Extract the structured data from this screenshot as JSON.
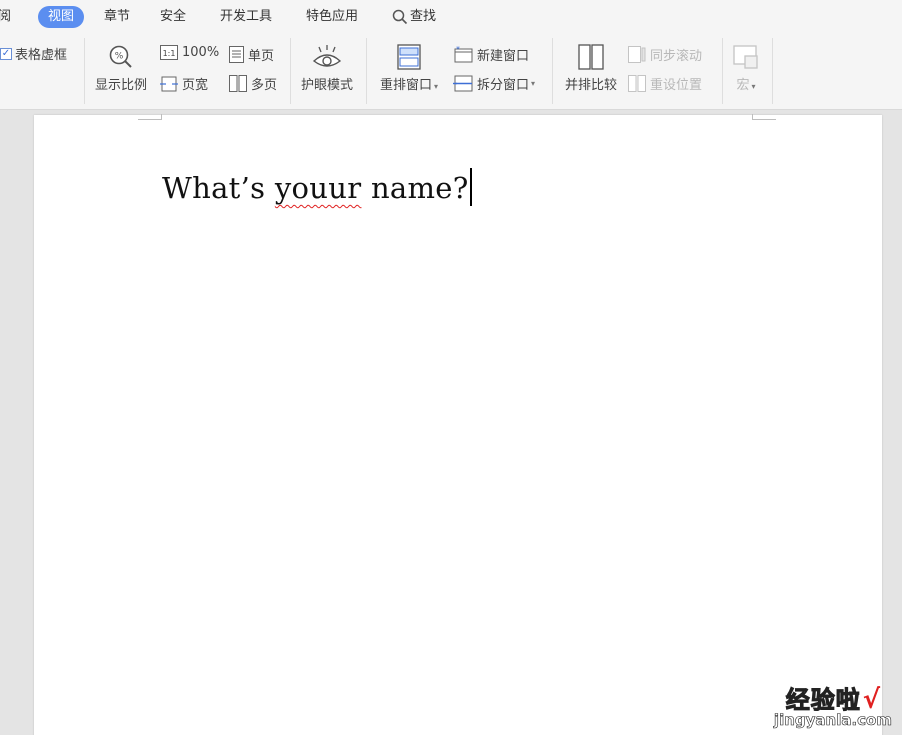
{
  "tabs": [
    {
      "label": "审阅"
    },
    {
      "label": "视图"
    },
    {
      "label": "章节"
    },
    {
      "label": "安全"
    },
    {
      "label": "开发工具"
    },
    {
      "label": "特色应用"
    },
    {
      "label": "查找"
    }
  ],
  "tab_visible_fragment": "阅",
  "ribbon": {
    "table_gridlines": {
      "label": "表格虚框",
      "checked": true
    },
    "zoom": {
      "label": "显示比例"
    },
    "zoom_100": {
      "label": "100%"
    },
    "single_page": {
      "label": "单页"
    },
    "page_width": {
      "label": "页宽"
    },
    "multi_page": {
      "label": "多页"
    },
    "eye_mode": {
      "label": "护眼模式"
    },
    "arrange_windows": {
      "label": "重排窗口"
    },
    "new_window": {
      "label": "新建窗口"
    },
    "split_window": {
      "label": "拆分窗口"
    },
    "side_by_side": {
      "label": "并排比较"
    },
    "sync_scroll": {
      "label": "同步滚动"
    },
    "reset_position": {
      "label": "重设位置"
    },
    "macro": {
      "label": "宏"
    }
  },
  "document": {
    "text_before": "What’s ",
    "misspelled_word": "youur",
    "text_after": " name?"
  },
  "watermark": {
    "chinese": "经验啦",
    "check": "√",
    "site": "jingyanla.com"
  },
  "colors": {
    "active_tab": "#5b8ef0",
    "spellcheck": "#e02020"
  }
}
